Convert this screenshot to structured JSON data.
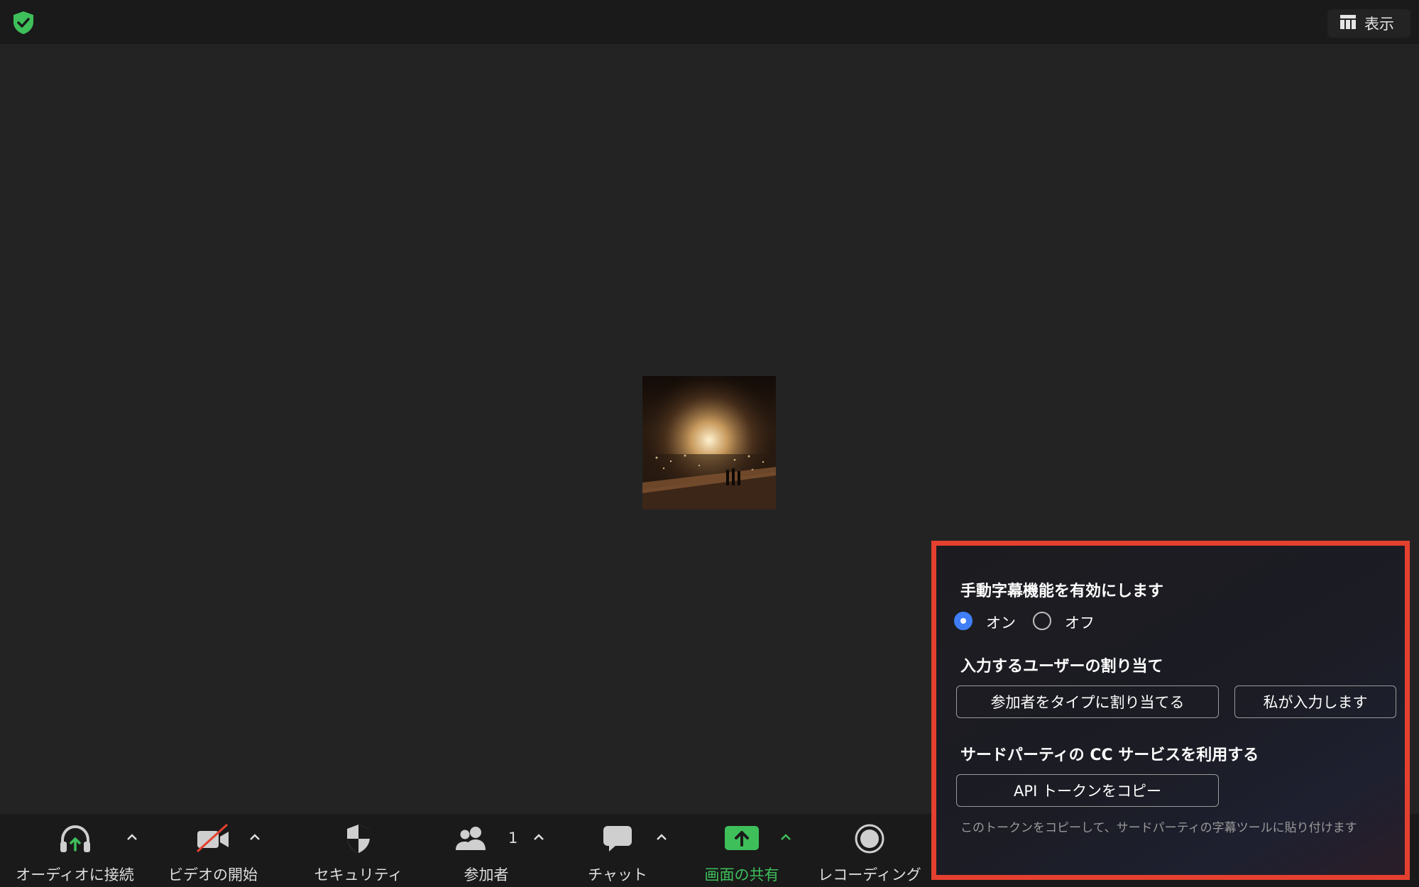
{
  "topbar": {
    "view_label": "表示"
  },
  "toolbar": {
    "audio_label": "オーディオに接続",
    "video_label": "ビデオの開始",
    "security_label": "セキュリティ",
    "participants_label": "参加者",
    "participants_count": "1",
    "chat_label": "チャット",
    "share_label": "画面の共有",
    "record_label": "レコーディング"
  },
  "captions_panel": {
    "enable_heading": "手動字幕機能を有効にします",
    "on_label": "オン",
    "off_label": "オフ",
    "selected": "on",
    "assign_heading": "入力するユーザーの割り当て",
    "assign_participant_button": "参加者をタイプに割り当てる",
    "assign_me_button": "私が入力します",
    "third_party_heading": "サードパーティの CC サービスを利用する",
    "copy_token_button": "API トークンをコピー",
    "note": "このトークンをコピーして、サードパーティの字幕ツールに貼り付けます"
  },
  "colors": {
    "accent_green": "#3ebf5a",
    "radio_blue": "#3f7ef6",
    "highlight_red": "#e5402f"
  }
}
